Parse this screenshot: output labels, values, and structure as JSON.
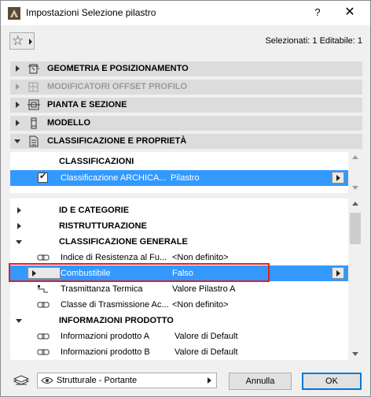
{
  "window": {
    "title": "Impostazioni Selezione pilastro",
    "help_glyph": "?",
    "close_glyph": "✕"
  },
  "toolbar": {
    "favorites_icon": "star-icon",
    "selection_info": "Selezionati: 1 Editabile: 1"
  },
  "panels": [
    {
      "label": "GEOMETRIA E POSIZIONAMENTO",
      "expanded": false,
      "enabled": true,
      "icon": "geometry-icon"
    },
    {
      "label": "MODIFICATORI OFFSET PROFILO",
      "expanded": false,
      "enabled": false,
      "icon": "profile-offset-icon"
    },
    {
      "label": "PIANTA E SEZIONE",
      "expanded": false,
      "enabled": true,
      "icon": "floor-plan-icon"
    },
    {
      "label": "MODELLO",
      "expanded": false,
      "enabled": true,
      "icon": "model-icon"
    },
    {
      "label": "CLASSIFICAZIONE E PROPRIETÀ",
      "expanded": true,
      "enabled": true,
      "icon": "document-icon"
    }
  ],
  "classifications": {
    "heading": "CLASSIFICAZIONI",
    "row": {
      "checked": true,
      "name": "Classificazione ARCHICA...",
      "value": "Pilastro"
    }
  },
  "properties": {
    "groups": [
      {
        "label": "ID E CATEGORIE",
        "expanded": false
      },
      {
        "label": "RISTRUTTURAZIONE",
        "expanded": false
      },
      {
        "label": "CLASSIFICAZIONE GENERALE",
        "expanded": true
      }
    ],
    "general_rows": [
      {
        "name": "Indice di Resistenza al Fu...",
        "value": "<Non definito>",
        "selected": false
      },
      {
        "name": "Combustibile",
        "value": "Falso",
        "selected": true
      },
      {
        "name": "Trasmittanza Termica",
        "value": "Valore Pilastro A",
        "selected": false
      },
      {
        "name": "Classe di Trasmissione Ac...",
        "value": "<Non definito>",
        "selected": false
      }
    ],
    "product_group": {
      "label": "INFORMAZIONI PRODOTTO",
      "expanded": true
    },
    "product_rows": [
      {
        "name": "Informazioni prodotto A",
        "value": "Valore di Default"
      },
      {
        "name": "Informazioni prodotto B",
        "value": "Valore di Default"
      }
    ]
  },
  "footer": {
    "view_option": "Strutturale - Portante",
    "cancel_label": "Annulla",
    "ok_label": "OK"
  },
  "colors": {
    "selection": "#3399ff",
    "highlight": "#e02020",
    "header": "#dcdcdc"
  }
}
